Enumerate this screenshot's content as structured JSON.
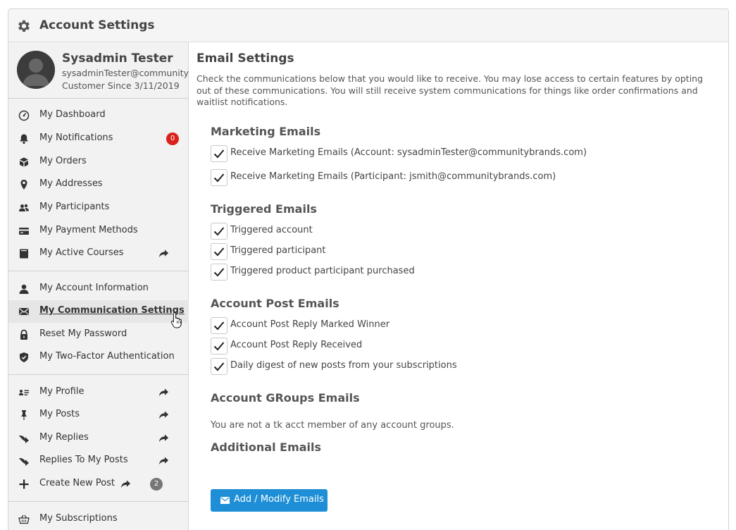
{
  "header": {
    "title": "Account Settings",
    "icon": "gear-icon"
  },
  "profile": {
    "name": "Sysadmin Tester",
    "email": "sysadminTester@communitybrands.com",
    "since": "Customer Since 3/11/2019"
  },
  "sidebar": {
    "group1": [
      {
        "label": "My Dashboard",
        "icon": "dashboard-icon"
      },
      {
        "label": "My Notifications",
        "icon": "bell-icon",
        "badge": "0"
      },
      {
        "label": "My Orders",
        "icon": "box-icon"
      },
      {
        "label": "My Addresses",
        "icon": "map-pin-icon"
      },
      {
        "label": "My Participants",
        "icon": "users-icon"
      },
      {
        "label": "My Payment Methods",
        "icon": "credit-card-icon"
      },
      {
        "label": "My Active Courses",
        "icon": "book-icon",
        "external": true
      }
    ],
    "group2": [
      {
        "label": "My Account Information",
        "icon": "user-icon"
      },
      {
        "label": "My Communication Settings",
        "icon": "envelope-icon",
        "active": true
      },
      {
        "label": "Reset My Password",
        "icon": "lock-icon"
      },
      {
        "label": "My Two-Factor Authentication",
        "icon": "shield-icon"
      }
    ],
    "group3": [
      {
        "label": "My Profile",
        "icon": "id-card-icon",
        "external": true
      },
      {
        "label": "My Posts",
        "icon": "pin-icon",
        "external": true
      },
      {
        "label": "My Replies",
        "icon": "reply-icon",
        "external": true
      },
      {
        "label": "Replies To My Posts",
        "icon": "reply-icon",
        "external": true
      },
      {
        "label": "Create New Post",
        "icon": "plus-icon",
        "external": true,
        "badge": "2"
      }
    ],
    "group4": [
      {
        "label": "My Subscriptions",
        "icon": "basket-icon"
      }
    ]
  },
  "main": {
    "title": "Email Settings",
    "intro": "Check the communications below that you would like to receive. You may lose access to certain features by opting out of these communications. You will still receive system communications for things like order confirmations and waitlist notifications.",
    "sections": {
      "marketing": {
        "title": "Marketing Emails",
        "items": [
          {
            "label": "Receive Marketing Emails (Account: sysadminTester@communitybrands.com)",
            "checked": true
          },
          {
            "label": "Receive Marketing Emails (Participant: jsmith@communitybrands.com)",
            "checked": true
          }
        ]
      },
      "triggered": {
        "title": "Triggered Emails",
        "items": [
          {
            "label": "Triggered account",
            "checked": true
          },
          {
            "label": "Triggered participant",
            "checked": true
          },
          {
            "label": "Triggered product participant purchased",
            "checked": true
          }
        ]
      },
      "account_post": {
        "title": "Account Post Emails",
        "items": [
          {
            "label": "Account Post Reply Marked Winner",
            "checked": true
          },
          {
            "label": "Account Post Reply Received",
            "checked": true
          },
          {
            "label": "Daily digest of new posts from your subscriptions",
            "checked": true
          }
        ]
      },
      "groups": {
        "title": "Account GRoups Emails",
        "note": "You are not a tk acct member of any account groups."
      },
      "additional": {
        "title": "Additional Emails"
      }
    },
    "button_label": "Add / Modify Emails"
  },
  "colors": {
    "accent": "#1e8fd6",
    "badge_red": "#d9221c",
    "badge_gray": "#777777",
    "sidebar_bg": "#f2f2f2"
  }
}
